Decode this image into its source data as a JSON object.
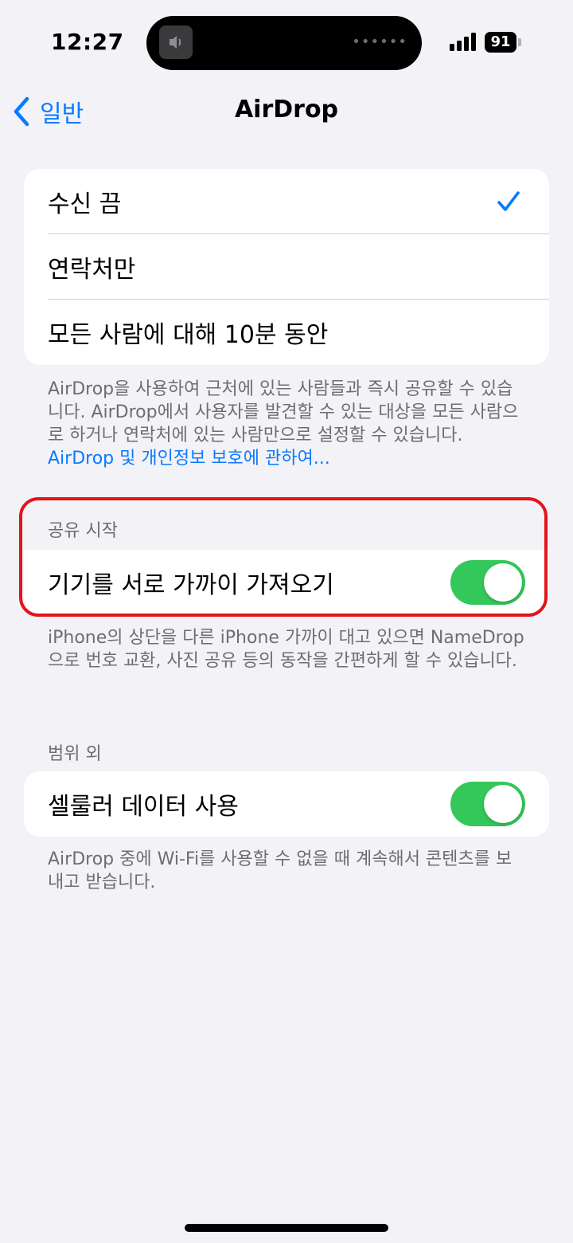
{
  "status_bar": {
    "time": "12:27",
    "battery": "91"
  },
  "nav": {
    "back_label": "일반",
    "title": "AirDrop"
  },
  "receive_options": [
    {
      "label": "수신 끔",
      "selected": true
    },
    {
      "label": "연락처만",
      "selected": false
    },
    {
      "label": "모든 사람에 대해 10분 동안",
      "selected": false
    }
  ],
  "receive_footer": {
    "text": "AirDrop을 사용하여 근처에 있는 사람들과 즉시 공유할 수 있습니다. AirDrop에서 사용자를 발견할 수 있는 대상을 모든 사람으로 하거나 연락처에 있는 사람만으로 설정할 수 있습니다.",
    "link": "AirDrop 및 개인정보 보호에 관하여..."
  },
  "start_sharing": {
    "header": "공유 시작",
    "row_label": "기기를 서로 가까이 가져오기",
    "toggle_on": true,
    "footer": "iPhone의 상단을 다른 iPhone 가까이 대고 있으면 NameDrop으로 번호 교환, 사진 공유 등의 동작을 간편하게 할 수 있습니다."
  },
  "out_of_range": {
    "header": "범위 외",
    "row_label": "셀룰러 데이터 사용",
    "toggle_on": true,
    "footer": "AirDrop 중에 Wi-Fi를 사용할 수 없을 때 계속해서 콘텐츠를 보내고 받습니다."
  },
  "colors": {
    "accent": "#0a7aff",
    "toggle_on": "#34c759",
    "highlight": "#e3141b",
    "background": "#f2f2f7"
  }
}
